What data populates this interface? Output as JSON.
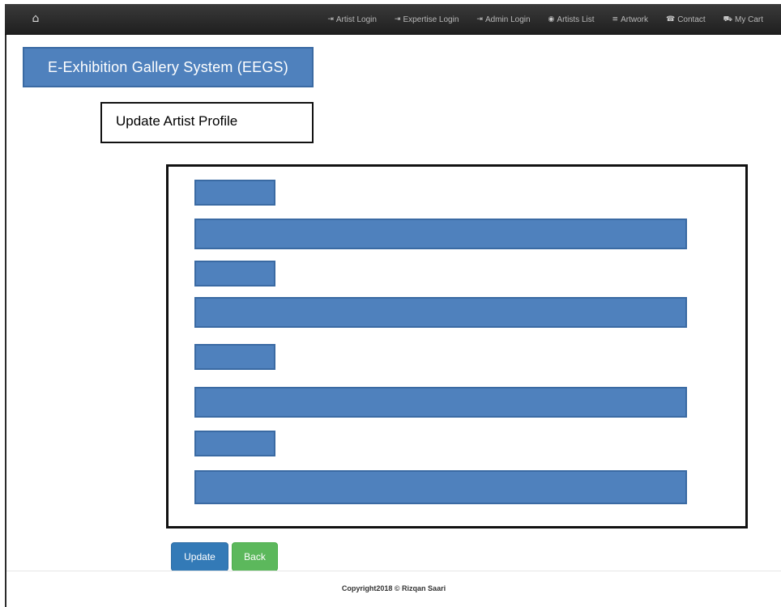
{
  "navbar": {
    "home_icon": "home-icon",
    "items": [
      {
        "icon": "login-icon",
        "glyph": "⇥",
        "label": "Artist Login"
      },
      {
        "icon": "login-icon",
        "glyph": "⇥",
        "label": "Expertise Login"
      },
      {
        "icon": "login-icon",
        "glyph": "⇥",
        "label": "Admin Login"
      },
      {
        "icon": "globe-icon",
        "glyph": "◉",
        "label": "Artists List"
      },
      {
        "icon": "list-icon",
        "glyph": "≡",
        "label": "Artwork"
      },
      {
        "icon": "phone-icon",
        "glyph": "☎",
        "label": "Contact"
      },
      {
        "icon": "cart-icon",
        "glyph": "⛟",
        "label": "My Cart"
      }
    ]
  },
  "brand": {
    "title": "E-Exhibition Gallery System (EEGS)"
  },
  "page": {
    "title": "Update Artist Profile"
  },
  "buttons": {
    "update": "Update",
    "back": "Back"
  },
  "footer": {
    "copyright": "Copyright2018 © Rizqan Saari"
  },
  "colors": {
    "placeholder_fill": "#4f81bd",
    "primary_button": "#337ab7",
    "success_button": "#5cb85c",
    "navbar": "#2a2a2a"
  }
}
